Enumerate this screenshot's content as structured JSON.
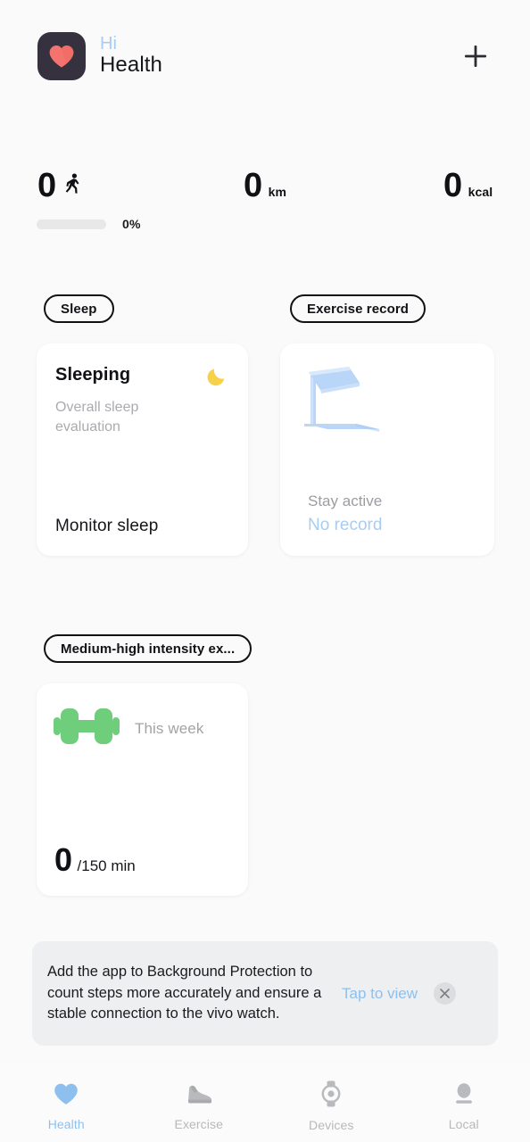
{
  "header": {
    "app_icon_name": "heart-app-icon",
    "greeting": "Hi",
    "app_name": "Health",
    "add_button_name": "add-button",
    "icon_bg": "#35313f",
    "heart_color": "#f4736f",
    "greeting_color": "#a8cdf0"
  },
  "stats": {
    "steps": {
      "value": "0",
      "icon": "walking-person-icon",
      "unit": ""
    },
    "distance": {
      "value": "0",
      "unit": "km"
    },
    "calories": {
      "value": "0",
      "unit": "kcal"
    },
    "progress": {
      "percent_label": "0%",
      "percent_value": 0,
      "track_color": "#e8e8e8"
    }
  },
  "sections": {
    "sleep": {
      "chip_label": "Sleep",
      "title": "Sleeping",
      "subtitle": "Overall sleep evaluation",
      "cta": "Monitor sleep",
      "icon": "crescent-moon-icon",
      "icon_color": "#f7d14a"
    },
    "exercise": {
      "chip_label": "Exercise record",
      "icon": "treadmill-icon",
      "icon_color": "#a8cdf5",
      "line1": "Stay active",
      "line2": "No record",
      "line2_color": "#a8cdf0"
    },
    "intensity": {
      "chip_label": "Medium-high intensity ex...",
      "icon": "dumbbell-icon",
      "icon_color": "#6ece7b",
      "period": "This week",
      "value": "0",
      "goal": "/150 min"
    }
  },
  "banner": {
    "message": "Add the app to Background Protection to count steps more accurately and ensure a stable connection to the vivo watch.",
    "action_label": "Tap to view",
    "action_color": "#8ec0ef",
    "close_icon": "close-icon",
    "background": "#eeeff0"
  },
  "tabbar": {
    "active_color": "#8ec0ef",
    "inactive_color": "#b7b8bc",
    "items": [
      {
        "label": "Health",
        "icon": "heart-icon",
        "active": true
      },
      {
        "label": "Exercise",
        "icon": "sneaker-icon",
        "active": false
      },
      {
        "label": "Devices",
        "icon": "watch-icon",
        "active": false
      },
      {
        "label": "Local",
        "icon": "person-icon",
        "active": false
      }
    ]
  }
}
